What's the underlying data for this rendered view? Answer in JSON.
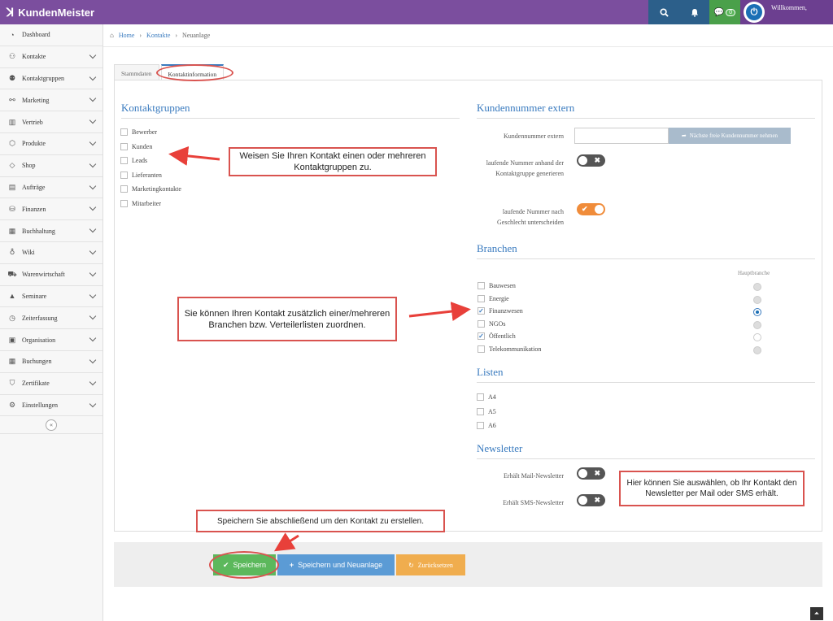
{
  "app": {
    "title": "KundenMeister",
    "welcome": "Willkommen,",
    "chat_count": "0"
  },
  "sidebar": {
    "items": [
      {
        "label": "Dashboard",
        "icon": "dashboard-icon",
        "glyph": "◔",
        "chevron": false
      },
      {
        "label": "Kontakte",
        "icon": "contacts-icon",
        "glyph": "⚇",
        "chevron": true
      },
      {
        "label": "Kontaktgruppen",
        "icon": "contact-groups-icon",
        "glyph": "⚉",
        "chevron": true
      },
      {
        "label": "Marketing",
        "icon": "marketing-icon",
        "glyph": "⚯",
        "chevron": true
      },
      {
        "label": "Vertrieb",
        "icon": "sales-chart-icon",
        "glyph": "▥",
        "chevron": true
      },
      {
        "label": "Produkte",
        "icon": "products-icon",
        "glyph": "⬡",
        "chevron": true
      },
      {
        "label": "Shop",
        "icon": "tag-icon",
        "glyph": "◇",
        "chevron": true
      },
      {
        "label": "Aufträge",
        "icon": "orders-icon",
        "glyph": "▤",
        "chevron": true
      },
      {
        "label": "Finanzen",
        "icon": "finance-icon",
        "glyph": "⛁",
        "chevron": true
      },
      {
        "label": "Buchhaltung",
        "icon": "accounting-icon",
        "glyph": "▦",
        "chevron": true
      },
      {
        "label": "Wiki",
        "icon": "lightbulb-icon",
        "glyph": "♁",
        "chevron": true
      },
      {
        "label": "Warenwirtschaft",
        "icon": "inventory-icon",
        "glyph": "⛟",
        "chevron": true
      },
      {
        "label": "Seminare",
        "icon": "graduation-icon",
        "glyph": "▲",
        "chevron": true
      },
      {
        "label": "Zeiterfassung",
        "icon": "clock-icon",
        "glyph": "◷",
        "chevron": true
      },
      {
        "label": "Organisation",
        "icon": "clipboard-icon",
        "glyph": "▣",
        "chevron": true
      },
      {
        "label": "Buchungen",
        "icon": "calendar-icon",
        "glyph": "▦",
        "chevron": true
      },
      {
        "label": "Zertifikate",
        "icon": "bookmark-icon",
        "glyph": "⛉",
        "chevron": true
      },
      {
        "label": "Einstellungen",
        "icon": "gear-icon",
        "glyph": "⚙",
        "chevron": true
      }
    ],
    "collapse_glyph": "«"
  },
  "breadcrumb": {
    "home": "Home",
    "contacts": "Kontakte",
    "current": "Neuanlage"
  },
  "tabs": [
    "Stammdaten",
    "Kontaktinformation"
  ],
  "groups": {
    "title": "Kontaktgruppen",
    "items": [
      "Bewerber",
      "Kunden",
      "Leads",
      "Lieferanten",
      "Marketingkontakte",
      "Mitarbeiter"
    ]
  },
  "customer_number": {
    "title": "Kundennummer extern",
    "field_label": "Kundennummer extern",
    "next_button": "Nächste freie Kundennummer nehmen",
    "auto_label": "laufende Nummer anhand der Kontaktgruppe generieren",
    "gender_label": "laufende Nummer nach Geschlecht unterscheiden"
  },
  "branches": {
    "title": "Branchen",
    "main_header": "Hauptbranche",
    "items": [
      {
        "label": "Bauwesen",
        "checked": false
      },
      {
        "label": "Energie",
        "checked": false
      },
      {
        "label": "Finanzwesen",
        "checked": true
      },
      {
        "label": "NGOs",
        "checked": false
      },
      {
        "label": "Öffentlich",
        "checked": true
      },
      {
        "label": "Telekommunikation",
        "checked": false
      }
    ]
  },
  "lists": {
    "title": "Listen",
    "items": [
      "A4",
      "A5",
      "A6"
    ]
  },
  "newsletter": {
    "title": "Newsletter",
    "mail_label": "Erhält Mail-Newsletter",
    "sms_label": "Erhält SMS-Newsletter"
  },
  "callouts": {
    "groups": "Weisen Sie Ihren Kontakt einen oder mehreren Kontaktgruppen zu.",
    "branches": "Sie können Ihren Kontakt zusätzlich einer/mehreren Branchen bzw. Verteilerlisten zuordnen.",
    "newsletter": "Hier können Sie auswählen, ob Ihr Kontakt den Newsletter per Mail oder SMS erhält.",
    "save": "Speichern Sie abschließend um den Kontakt zu erstellen."
  },
  "buttons": {
    "save": "Speichern",
    "save_new": "Speichern und Neuanlage",
    "reset": "Zurücksetzen"
  },
  "colors": {
    "topbar": "#7b4e9e",
    "accent": "#3a7bbf",
    "callout_border": "#d9534f",
    "save": "#5cb85c",
    "save_new": "#5b9bd5",
    "reset": "#f0ad4e"
  }
}
